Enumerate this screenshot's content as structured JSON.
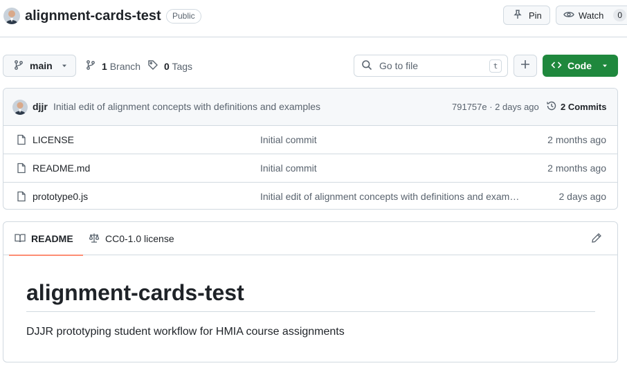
{
  "repo": {
    "name": "alignment-cards-test",
    "visibility": "Public",
    "pin_label": "Pin",
    "watch_label": "Watch",
    "watch_count": "0"
  },
  "toolbar": {
    "branch": "main",
    "branch_count": "1",
    "branch_label": "Branch",
    "tag_count": "0",
    "tag_label": "Tags",
    "goto_placeholder": "Go to file",
    "goto_shortcut": "t",
    "code_label": "Code"
  },
  "latest_commit": {
    "author": "djjr",
    "message": "Initial edit of alignment concepts with definitions and examples",
    "meta": "791757e · 2 days ago",
    "commits_label": "2 Commits"
  },
  "files": [
    {
      "name": "LICENSE",
      "commit": "Initial commit",
      "date": "2 months ago"
    },
    {
      "name": "README.md",
      "commit": "Initial commit",
      "date": "2 months ago"
    },
    {
      "name": "prototype0.js",
      "commit": "Initial edit of alignment concepts with definitions and examples",
      "date": "2 days ago"
    }
  ],
  "readme": {
    "tab_readme": "README",
    "tab_license": "CC0-1.0 license",
    "title": "alignment-cards-test",
    "text": "DJJR prototyping student workflow for HMIA course assignments"
  },
  "colors": {
    "accent_green": "#1f883d",
    "tab_underline": "#fd8c73",
    "border": "#d1d9e0"
  }
}
